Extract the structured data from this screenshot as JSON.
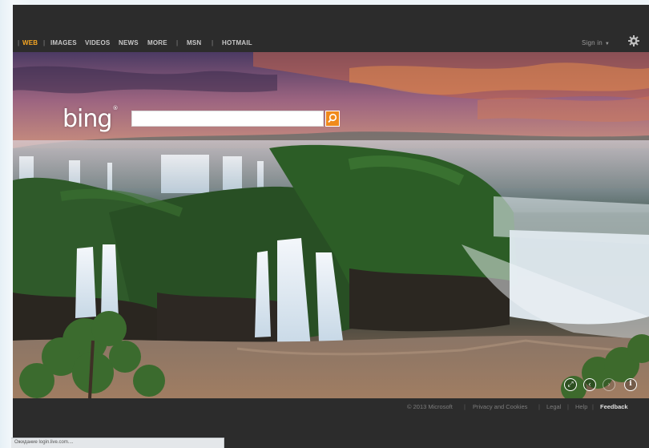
{
  "nav": {
    "items": [
      {
        "label": "WEB",
        "active": true
      },
      {
        "label": "IMAGES",
        "active": false
      },
      {
        "label": "VIDEOS",
        "active": false
      },
      {
        "label": "NEWS",
        "active": false
      },
      {
        "label": "MORE",
        "active": false
      },
      {
        "label": "MSN",
        "active": false
      },
      {
        "label": "HOTMAIL",
        "active": false
      }
    ],
    "signin": "Sign in",
    "gear_icon": "gear-icon"
  },
  "logo": {
    "text": "bing",
    "trademark": "®"
  },
  "search": {
    "value": "",
    "placeholder": "",
    "button_icon": "search-icon"
  },
  "image_controls": [
    {
      "icon": "expand-icon",
      "symbol": "⤢"
    },
    {
      "icon": "prev-icon",
      "symbol": "‹"
    },
    {
      "icon": "next-icon",
      "symbol": "›"
    },
    {
      "icon": "info-icon",
      "symbol": "i"
    }
  ],
  "footer": {
    "copyright": "© 2013 Microsoft",
    "links": [
      "Privacy and Cookies",
      "Legal",
      "Help"
    ],
    "feedback": "Feedback"
  },
  "status": {
    "text": "Ожидание login.live.com...."
  },
  "colors": {
    "accent": "#f5a623",
    "search_button": "#f08a1c",
    "chrome": "#2c2c2c"
  }
}
